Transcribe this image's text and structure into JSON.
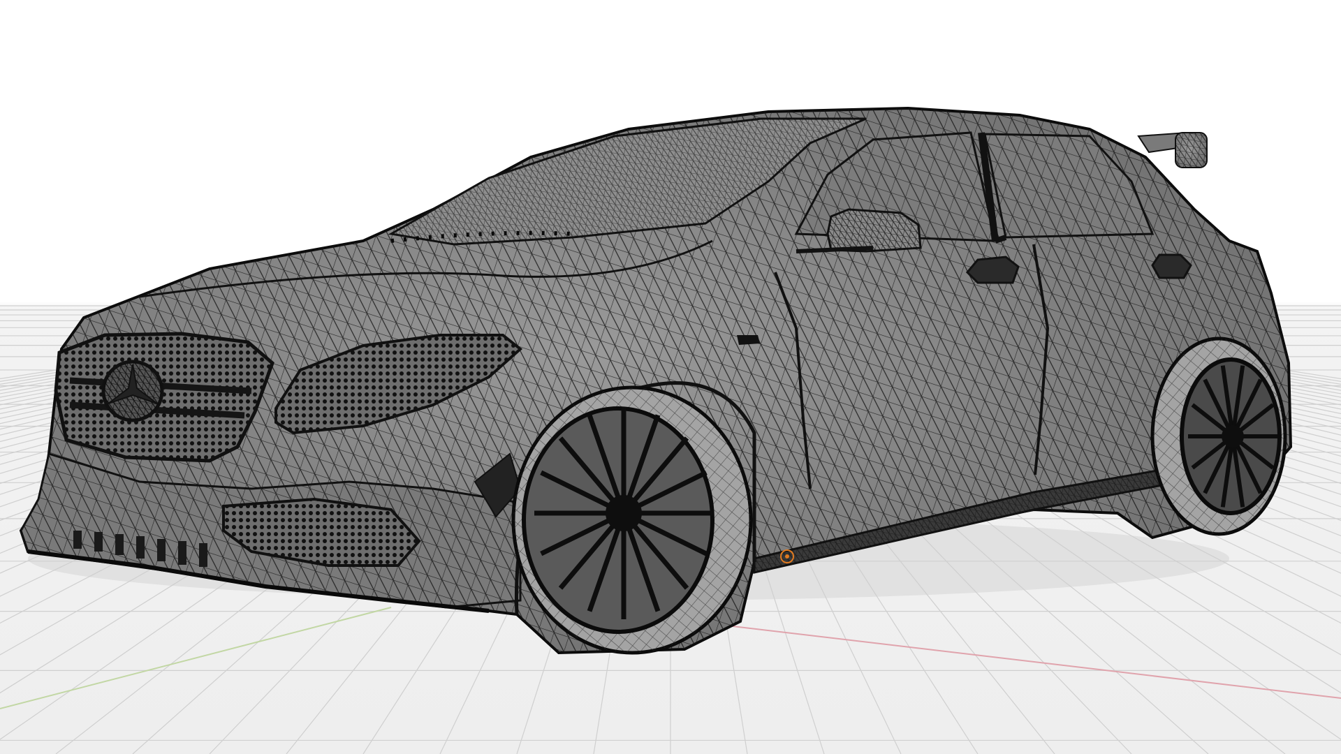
{
  "app": {
    "name": ""
  },
  "viewport": {
    "shading_mode": "wireframe",
    "colors": {
      "background": "#ffffff",
      "floor": "#eeeeee",
      "grid_line": "#cfcfcf",
      "x_axis": "#d9a0a8",
      "y_axis": "#b9cf9c",
      "mesh_fill": "#8c8c8c",
      "mesh_dark": "#5f5f5f",
      "wire": "#111111",
      "origin": "#e07a20"
    },
    "object": {
      "type": "car-mesh",
      "icon": "object-origin-icon"
    }
  }
}
